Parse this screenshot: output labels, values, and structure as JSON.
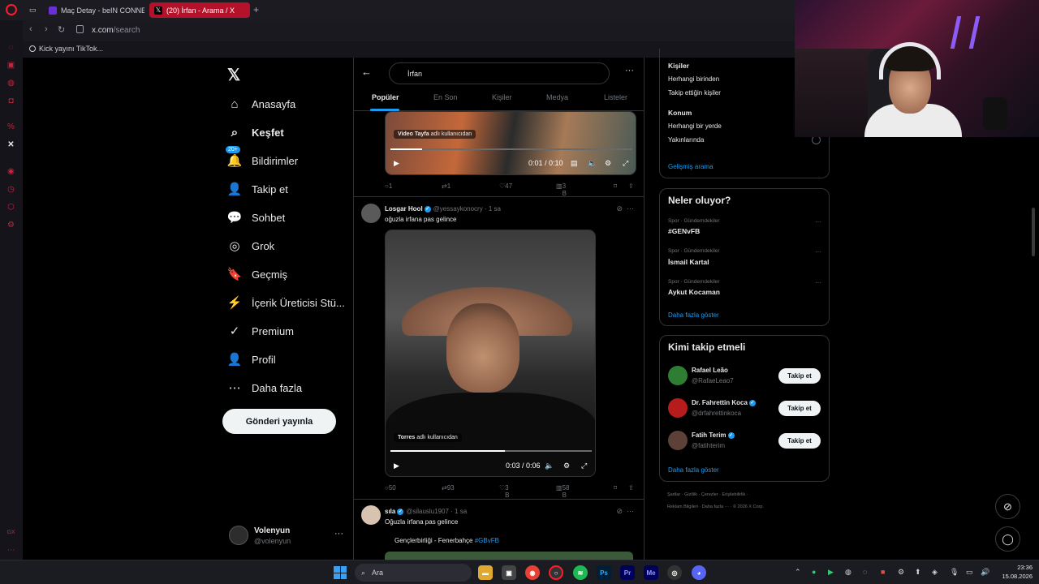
{
  "browser": {
    "tabs": [
      {
        "label": ""
      },
      {
        "label": "Maç Detay - beIN CONNECT"
      },
      {
        "label": "(20) İrfan - Arama / X"
      }
    ],
    "url_host": "x.com",
    "url_path": "/search",
    "bookmark": "Kick yayını TikTok..."
  },
  "nav": {
    "logo": "𝕏",
    "items": [
      {
        "label": "Anasayfa",
        "icon": "⌂"
      },
      {
        "label": "Keşfet",
        "icon": "⌕"
      },
      {
        "label": "Bildirimler",
        "icon": "🔔",
        "badge": "20+"
      },
      {
        "label": "Takip et",
        "icon": "👤"
      },
      {
        "label": "Sohbet",
        "icon": "💬"
      },
      {
        "label": "Grok",
        "icon": "◎"
      },
      {
        "label": "Geçmiş",
        "icon": "🔖"
      },
      {
        "label": "İçerik Üreticisi Stü...",
        "icon": "⚡"
      },
      {
        "label": "Premium",
        "icon": "✓"
      },
      {
        "label": "Profil",
        "icon": "👤"
      },
      {
        "label": "Daha fazla",
        "icon": "⋯"
      }
    ],
    "post_button": "Gönderi yayınla",
    "account_name": "Volenyun",
    "account_handle": "@volenyun"
  },
  "search": {
    "query": "İrfan",
    "tabs": [
      "Popüler",
      "En Son",
      "Kişiler",
      "Medya",
      "Listeler"
    ]
  },
  "tweets": [
    {
      "video_credit_name": "Video Tayfa",
      "video_credit_suffix": "adlı kullanıcıdan",
      "time": "0:01 / 0:10",
      "replies": "1",
      "reposts": "1",
      "likes": "47",
      "views": "3 B"
    },
    {
      "name": "Losgar Hool",
      "handle": "@yessaykonocry · 1 sa",
      "text": "oğuzla irfana pas gelince",
      "video_credit_name": "Torres",
      "video_credit_suffix": "adlı kullanıcıdan",
      "time": "0:03 / 0:06",
      "replies": "50",
      "reposts": "93",
      "likes": "3 B",
      "views": "58 B"
    },
    {
      "name": "sıla",
      "handle": "@silauslu1907 · 1 sa",
      "text": "Oğuzla irfana pas gelince",
      "quote_text": "Gençlerbirliği - Fenerbahçe",
      "quote_tag": "#GBvFB"
    }
  ],
  "filters": {
    "people_title": "Kişiler",
    "people_opts": [
      "Herhangi birinden",
      "Takip ettiğin kişiler"
    ],
    "location_title": "Konum",
    "location_opts": [
      "Herhangi bir yerde",
      "Yakınlarında"
    ],
    "advanced": "Gelişmiş arama"
  },
  "trends": {
    "title": "Neler oluyor?",
    "items": [
      {
        "context": "Spor · Gündemdekiler",
        "name": "#GENvFB"
      },
      {
        "context": "Spor · Gündemdekiler",
        "name": "İsmail Kartal"
      },
      {
        "context": "Spor · Gündemdekiler",
        "name": "Aykut Kocaman"
      }
    ],
    "more": "Daha fazla göster"
  },
  "who_to_follow": {
    "title": "Kimi takip etmeli",
    "items": [
      {
        "name": "Rafael Leão",
        "handle": "@RafaeLeao7",
        "verified": false,
        "button": "Takip et"
      },
      {
        "name": "Dr. Fahrettin Koca",
        "handle": "@drfahrettinkoca",
        "verified": true,
        "button": "Takip et"
      },
      {
        "name": "Fatih Terim",
        "handle": "@fatihterim",
        "verified": true,
        "button": "Takip et"
      }
    ],
    "more": "Daha fazla göster"
  },
  "footer": {
    "line1": "Şartlar  ·  Gizlilik  ·  Çerezler  ·  Erişilebilirlik  ·",
    "line2": "Reklam Bilgileri  ·  Daha fazla ···  ·  © 2026 X Corp."
  },
  "taskbar": {
    "search": "Ara",
    "time": "23:36",
    "date": "15.08.2026"
  }
}
